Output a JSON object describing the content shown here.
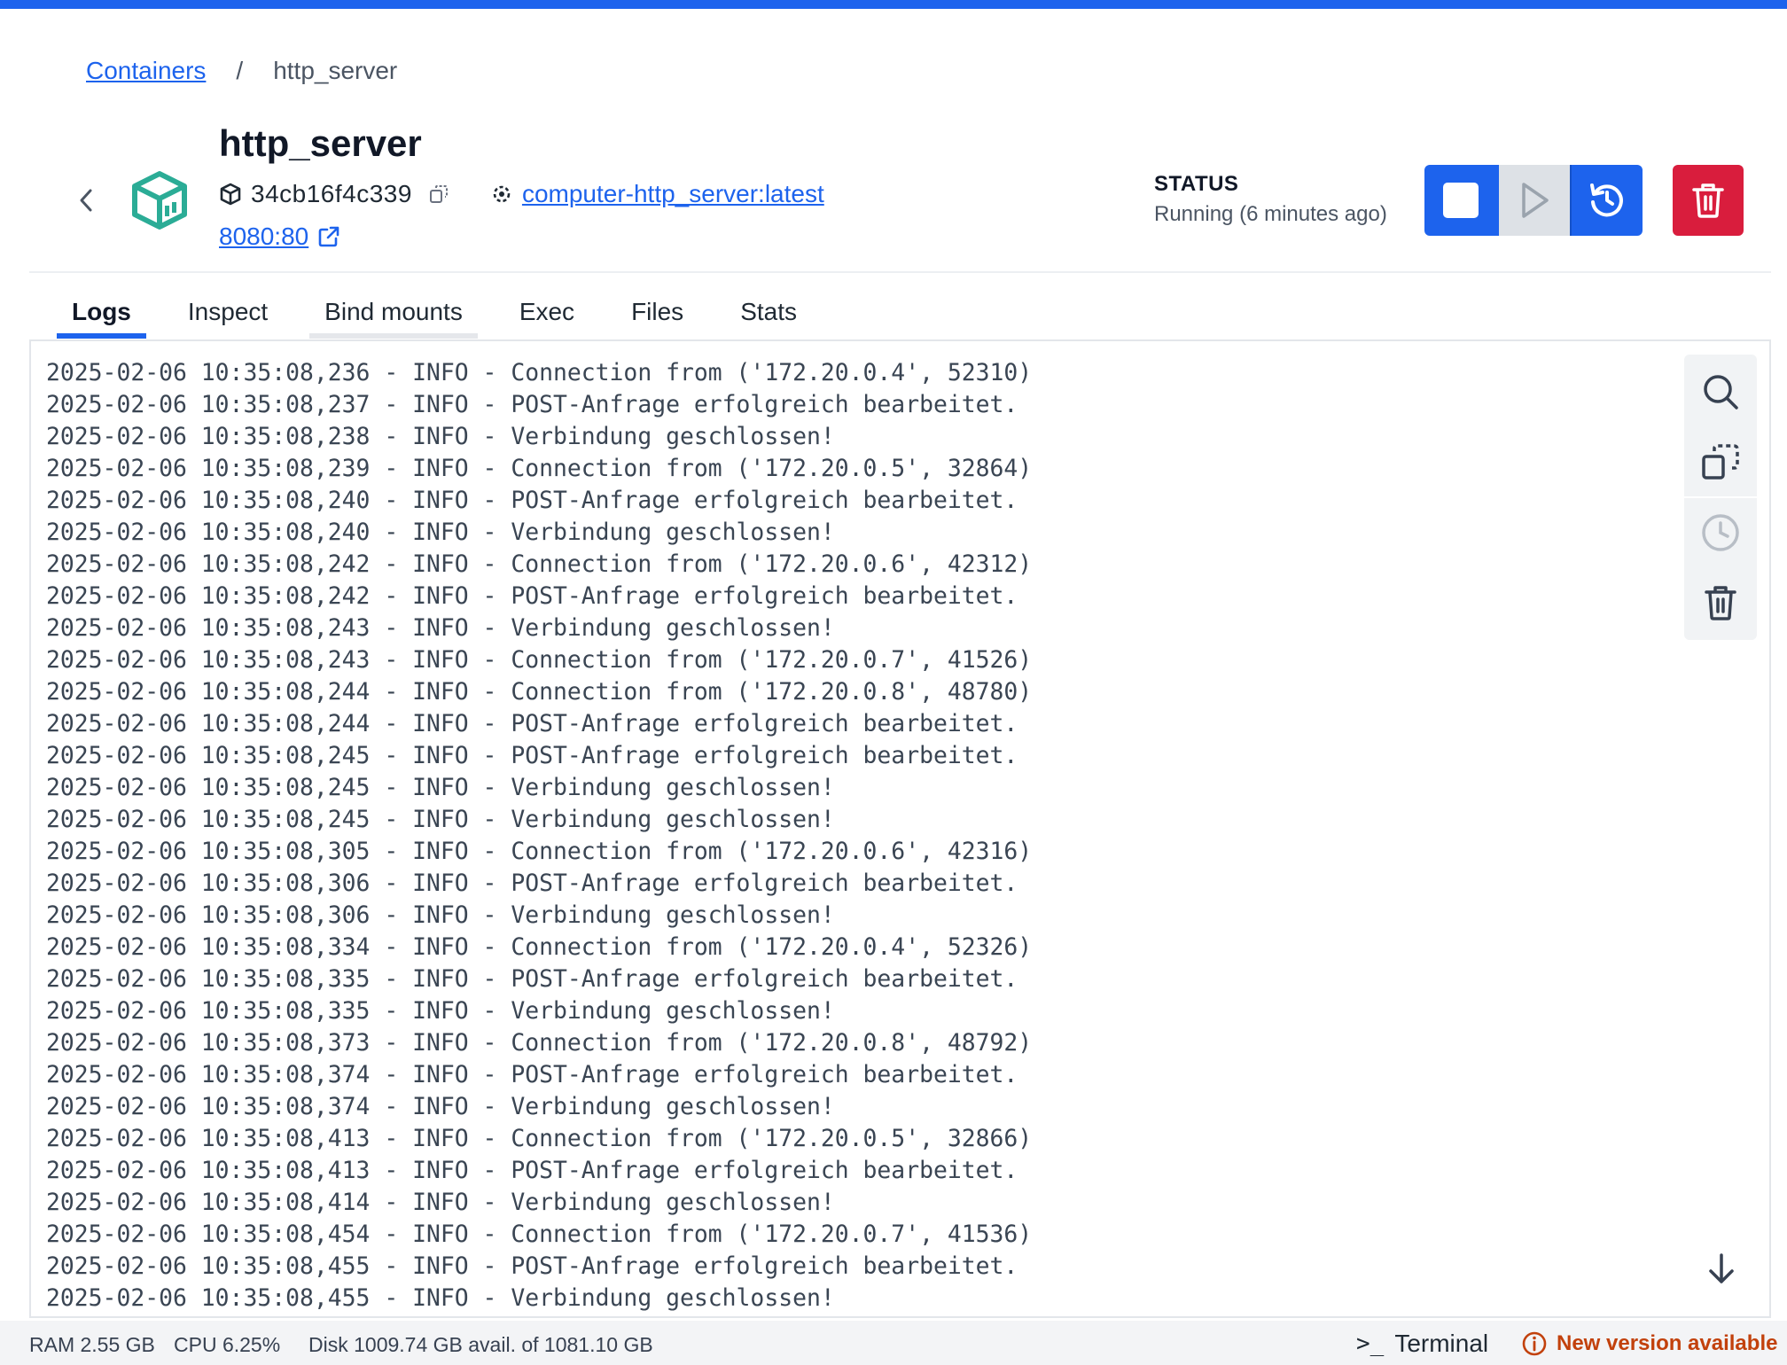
{
  "breadcrumb": {
    "root": "Containers",
    "separator": "/",
    "current": "http_server"
  },
  "container": {
    "name": "http_server",
    "id": "34cb16f4c339",
    "image": "computer-http_server:latest",
    "port": "8080:80"
  },
  "status": {
    "label": "STATUS",
    "value": "Running (6 minutes ago)"
  },
  "tabs": [
    {
      "label": "Logs",
      "active": true
    },
    {
      "label": "Inspect"
    },
    {
      "label": "Bind mounts"
    },
    {
      "label": "Exec"
    },
    {
      "label": "Files"
    },
    {
      "label": "Stats"
    }
  ],
  "logs": [
    "2025-02-06 10:35:08,236 - INFO - Connection from ('172.20.0.4', 52310)",
    "2025-02-06 10:35:08,237 - INFO - POST-Anfrage erfolgreich bearbeitet.",
    "2025-02-06 10:35:08,238 - INFO - Verbindung geschlossen!",
    "2025-02-06 10:35:08,239 - INFO - Connection from ('172.20.0.5', 32864)",
    "2025-02-06 10:35:08,240 - INFO - POST-Anfrage erfolgreich bearbeitet.",
    "2025-02-06 10:35:08,240 - INFO - Verbindung geschlossen!",
    "2025-02-06 10:35:08,242 - INFO - Connection from ('172.20.0.6', 42312)",
    "2025-02-06 10:35:08,242 - INFO - POST-Anfrage erfolgreich bearbeitet.",
    "2025-02-06 10:35:08,243 - INFO - Verbindung geschlossen!",
    "2025-02-06 10:35:08,243 - INFO - Connection from ('172.20.0.7', 41526)",
    "2025-02-06 10:35:08,244 - INFO - Connection from ('172.20.0.8', 48780)",
    "2025-02-06 10:35:08,244 - INFO - POST-Anfrage erfolgreich bearbeitet.",
    "2025-02-06 10:35:08,245 - INFO - POST-Anfrage erfolgreich bearbeitet.",
    "2025-02-06 10:35:08,245 - INFO - Verbindung geschlossen!",
    "2025-02-06 10:35:08,245 - INFO - Verbindung geschlossen!",
    "2025-02-06 10:35:08,305 - INFO - Connection from ('172.20.0.6', 42316)",
    "2025-02-06 10:35:08,306 - INFO - POST-Anfrage erfolgreich bearbeitet.",
    "2025-02-06 10:35:08,306 - INFO - Verbindung geschlossen!",
    "2025-02-06 10:35:08,334 - INFO - Connection from ('172.20.0.4', 52326)",
    "2025-02-06 10:35:08,335 - INFO - POST-Anfrage erfolgreich bearbeitet.",
    "2025-02-06 10:35:08,335 - INFO - Verbindung geschlossen!",
    "2025-02-06 10:35:08,373 - INFO - Connection from ('172.20.0.8', 48792)",
    "2025-02-06 10:35:08,374 - INFO - POST-Anfrage erfolgreich bearbeitet.",
    "2025-02-06 10:35:08,374 - INFO - Verbindung geschlossen!",
    "2025-02-06 10:35:08,413 - INFO - Connection from ('172.20.0.5', 32866)",
    "2025-02-06 10:35:08,413 - INFO - POST-Anfrage erfolgreich bearbeitet.",
    "2025-02-06 10:35:08,414 - INFO - Verbindung geschlossen!",
    "2025-02-06 10:35:08,454 - INFO - Connection from ('172.20.0.7', 41536)",
    "2025-02-06 10:35:08,455 - INFO - POST-Anfrage erfolgreich bearbeitet.",
    "2025-02-06 10:35:08,455 - INFO - Verbindung geschlossen!"
  ],
  "footer": {
    "ram": "RAM 2.55 GB",
    "cpu": "CPU 6.25%",
    "disk": "Disk 1009.74 GB avail. of 1081.10 GB",
    "terminal_glyph": ">_",
    "terminal": "Terminal",
    "update": "New version available"
  },
  "icons": {
    "back": "chevron-left-icon",
    "logo": "container-cube-icon",
    "id": "cube-icon",
    "copy": "copy-icon",
    "image": "image-layers-icon",
    "external": "external-link-icon",
    "stop": "stop-icon",
    "start": "play-icon",
    "restart": "restart-icon",
    "delete": "trash-icon",
    "search": "search-icon",
    "copy_logs": "copy-icon",
    "timestamps": "clock-icon",
    "clear": "trash-icon",
    "scroll_bottom": "arrow-down-icon",
    "info": "info-icon"
  },
  "colors": {
    "accent": "#1d63ed",
    "danger": "#d91d3d",
    "logo": "#2bac96",
    "update": "#c2410c"
  }
}
